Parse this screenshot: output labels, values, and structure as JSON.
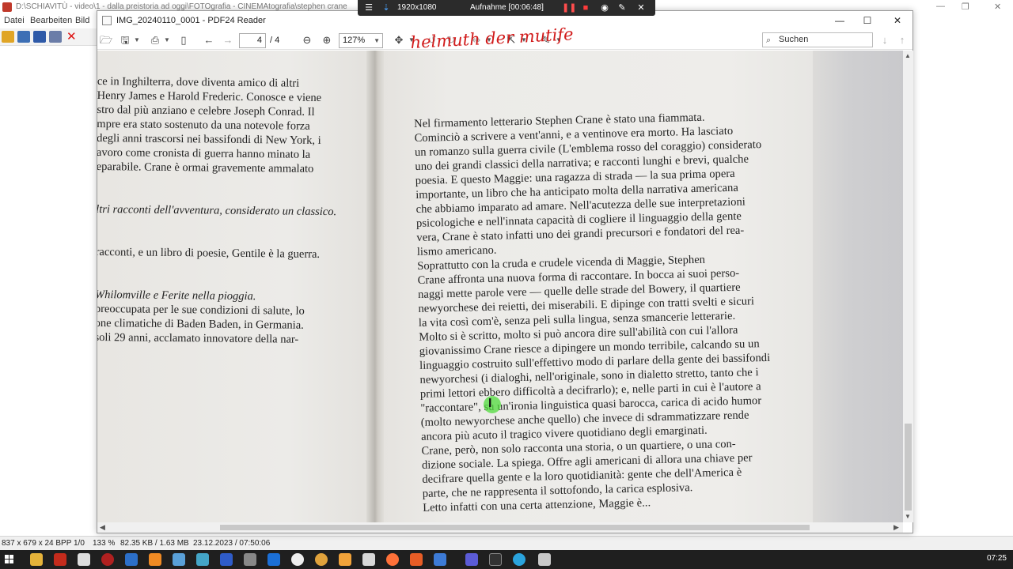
{
  "background_app": {
    "title": "D:\\SCHIAVITÙ - video\\1 - dalla preistoria ad oggi\\FOTOgrafia - CINEMAtografia\\stephen crane",
    "menu": [
      "Datei",
      "Bearbeiten",
      "Bild"
    ],
    "status": {
      "dimensions": "837 x 679 x 24 BPP",
      "index": "1/0",
      "zoom": "133 %",
      "size": "82.35 KB / 1.63 MB",
      "datetime": "23.12.2023 / 07:50:06"
    }
  },
  "recorder": {
    "resolution": "1920x1080",
    "recording": "Aufnahme [00:06:48]"
  },
  "window": {
    "title": "IMG_20240110_0001 - PDF24 Reader",
    "page_current": "4",
    "page_total": "/ 4",
    "zoom": "127%",
    "search_placeholder": "Suchen",
    "scribble": "helmuth der mutife"
  },
  "document": {
    "left_lines": [
      "ce in Inghilterra, dove diventa amico di altri",
      "Henry James e Harold Frederic. Conosce e viene",
      "stro dal più anziano e celebre Joseph Conrad. Il",
      "mpre era stato sostenuto da una notevole forza",
      "degli anni trascorsi nei bassifondi di New York, i",
      "avoro come cronista di guerra hanno minato la",
      "eparabile. Crane è ormai gravemente ammalato",
      "",
      "",
      "ltri racconti dell'avventura, considerato un classico.",
      "",
      "",
      "racconti, e un libro di poesie, Gentile è la guerra.",
      "",
      "",
      "Whilomville e Ferite nella pioggia.",
      "preoccupata per le sue condizioni di salute, lo",
      "one climatiche di Baden Baden, in Germania.",
      " soli 29 anni, acclamato innovatore della nar-"
    ],
    "right_lines": [
      "      Nel firmamento letterario Stephen Crane è stato una fiammata.",
      "Cominciò a scrivere a vent'anni, e a ventinove era morto. Ha lasciato",
      "un romanzo sulla guerra civile (L'emblema rosso del coraggio) considerato",
      "uno dei grandi classici della narrativa; e racconti lunghi e brevi, qualche",
      "poesia. E questo Maggie: una ragazza di strada — la sua prima opera",
      "importante, un libro che ha anticipato molta della narrativa americana",
      "che abbiamo imparato ad amare. Nell'acutezza delle sue interpretazioni",
      "psicologiche e nell'innata capacità di cogliere il linguaggio della gente",
      "vera, Crane è stato infatti uno dei grandi precursori e fondatori del rea-",
      "lismo americano.",
      "      Soprattutto con la cruda e crudele vicenda di Maggie, Stephen",
      "Crane affronta una nuova forma di raccontare. In bocca ai suoi perso-",
      "naggi mette parole vere — quelle delle strade del Bowery, il quartiere",
      "newyorchese dei reietti, dei miserabili. E dipinge con tratti svelti e sicuri",
      "la vita così com'è, senza peli sulla lingua, senza smancerie letterarie.",
      "      Molto si è scritto, molto si può ancora dire sull'abilità con cui l'allora",
      "giovanissimo Crane riesce a dipingere un mondo terribile, calcando su un",
      "linguaggio costruito sull'effettivo modo di parlare della gente dei bassifondi",
      "newyorchesi (i dialoghi, nell'originale, sono in dialetto stretto, tanto che i",
      "primi lettori ebbero difficoltà a decifrarlo); e, nelle parti in cui è l'autore a",
      "\"raccontare\", su un'ironia linguistica quasi barocca, carica di acido humor",
      "(molto newyorchese anche quello) che invece di sdrammatizzare rende",
      "ancora più acuto il tragico vivere quotidiano degli emarginati.",
      "      Crane, però, non solo racconta una storia, o un quartiere, o una con-",
      "dizione sociale. La spiega. Offre agli americani di allora una chiave per",
      "decifrare quella gente e la loro quotidianità: gente che dell'America è",
      "parte, che ne rappresenta il sottofondo, la carica esplosiva.",
      "      Letto infatti con una certa attenzione, Maggie è..."
    ]
  },
  "taskbar": {
    "clock": "07:25"
  },
  "colors": {
    "taskbar": "#1f1f1f",
    "recorder": "#2b2b2b",
    "cursor_highlight": "#50dc3c",
    "scribble": "#d11a1a"
  }
}
